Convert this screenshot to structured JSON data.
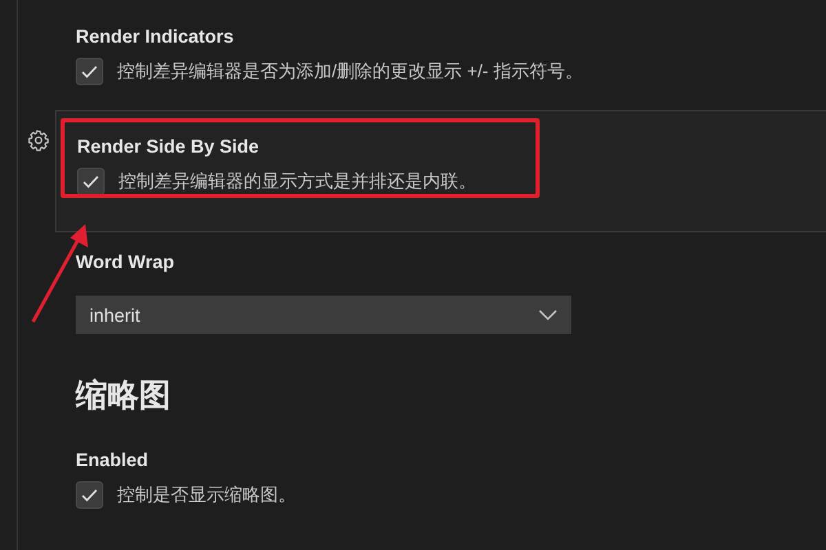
{
  "settings": [
    {
      "kind": "checkbox",
      "title": "Render Indicators",
      "description": "控制差异编辑器是否为添加/删除的更改显示 +/- 指示符号。",
      "checked": true,
      "focused": false,
      "annotated": false
    },
    {
      "kind": "checkbox",
      "title": "Render Side By Side",
      "description": "控制差异编辑器的显示方式是并排还是内联。",
      "checked": true,
      "focused": true,
      "annotated": true
    },
    {
      "kind": "select",
      "title": "Word Wrap",
      "value": "inherit",
      "focused": false,
      "annotated": false
    },
    {
      "kind": "heading",
      "title": "缩略图"
    },
    {
      "kind": "checkbox",
      "title": "Enabled",
      "description": "控制是否显示缩略图。",
      "checked": true,
      "focused": false,
      "annotated": false
    }
  ]
}
